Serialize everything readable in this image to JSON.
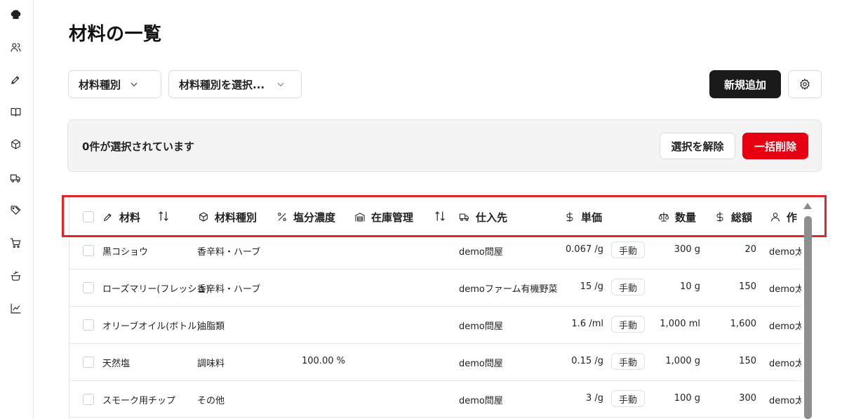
{
  "page": {
    "title": "材料の一覧"
  },
  "sidebar": {
    "icons": [
      "chef-hat-icon",
      "users-icon",
      "pen-icon",
      "book-icon",
      "box-icon",
      "truck-icon",
      "tags-icon",
      "cart-icon",
      "cooking-pot-icon",
      "chart-icon"
    ]
  },
  "filters": {
    "type_label": "材料種別",
    "type_select_placeholder": "材料種別を選択..."
  },
  "toolbar": {
    "add_label": "新規追加"
  },
  "selection": {
    "status": "0件が選択されています",
    "clear_label": "選択を解除",
    "bulk_delete_label": "一括削除"
  },
  "table": {
    "columns": {
      "material": "材料",
      "type": "材料種別",
      "salt": "塩分濃度",
      "stock": "在庫管理",
      "supplier": "仕入先",
      "unit_price": "単価",
      "quantity": "数量",
      "total": "総額",
      "author": "作"
    },
    "rows": [
      {
        "material": "黒コショウ",
        "type": "香辛料・ハーブ",
        "salt": "",
        "supplier": "demo問屋",
        "price": "0.067 /g",
        "mode": "手動",
        "qty": "300 g",
        "total": "20",
        "author": "demo太郎"
      },
      {
        "material": "ローズマリー(フレッシュ)",
        "type": "香辛料・ハーブ",
        "salt": "",
        "supplier": "demoファーム有機野菜",
        "price": "15 /g",
        "mode": "手動",
        "qty": "10 g",
        "total": "150",
        "author": "demo太郎"
      },
      {
        "material": "オリーブオイル(ボトル)",
        "type": "油脂類",
        "salt": "",
        "supplier": "demo問屋",
        "price": "1.6 /ml",
        "mode": "手動",
        "qty": "1,000 ml",
        "total": "1,600",
        "author": "demo太郎"
      },
      {
        "material": "天然塩",
        "type": "調味料",
        "salt": "100.00 %",
        "supplier": "demo問屋",
        "price": "0.15 /g",
        "mode": "手動",
        "qty": "1,000 g",
        "total": "150",
        "author": "demo太郎"
      },
      {
        "material": "スモーク用チップ",
        "type": "その他",
        "salt": "",
        "supplier": "demo問屋",
        "price": "3 /g",
        "mode": "手動",
        "qty": "100 g",
        "total": "300",
        "author": "demo太郎"
      }
    ]
  }
}
